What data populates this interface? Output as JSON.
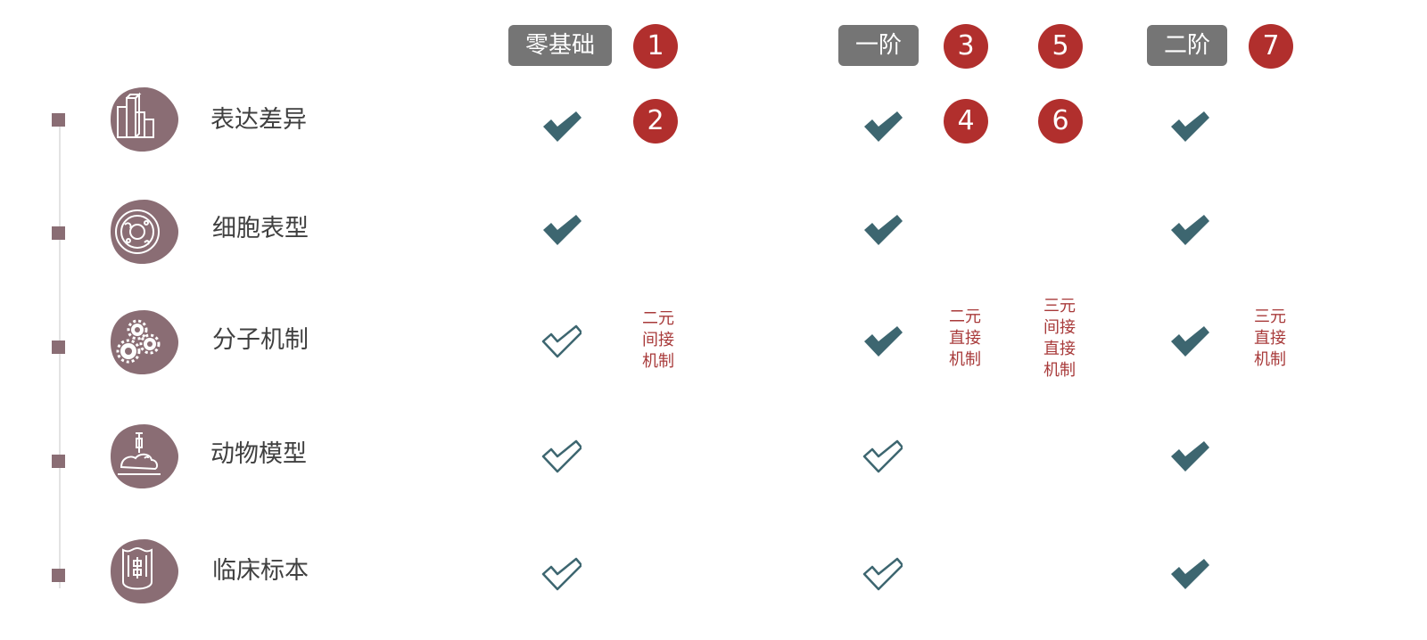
{
  "colors": {
    "icon_fill": "#8a6d74",
    "tag_bg": "#757575",
    "number_bg": "#b12f2d",
    "check": "#3d6670",
    "note_text": "#a83a3a"
  },
  "levels": {
    "zero": "零基础",
    "one": "一阶",
    "two": "二阶"
  },
  "numbers": [
    "1",
    "2",
    "3",
    "4",
    "5",
    "6",
    "7"
  ],
  "rows": [
    {
      "label": "表达差异",
      "icon": "bar-chart-icon"
    },
    {
      "label": "细胞表型",
      "icon": "cell-icon"
    },
    {
      "label": "分子机制",
      "icon": "gears-icon"
    },
    {
      "label": "动物模型",
      "icon": "animal-experiment-icon"
    },
    {
      "label": "临床标本",
      "icon": "clinical-body-icon"
    }
  ],
  "checks": {
    "zero": [
      "filled",
      "filled",
      "outline",
      "outline",
      "outline"
    ],
    "one": [
      "filled",
      "filled",
      "filled",
      "outline",
      "outline"
    ],
    "two": [
      "filled",
      "filled",
      "filled",
      "filled",
      "filled"
    ]
  },
  "mechanism_notes": {
    "n2": [
      "二元",
      "间接",
      "机制"
    ],
    "n4": [
      "二元",
      "直接",
      "机制"
    ],
    "n6": [
      "三元",
      "间接",
      "直接",
      "机制"
    ],
    "n7": [
      "三元",
      "直接",
      "机制"
    ]
  }
}
